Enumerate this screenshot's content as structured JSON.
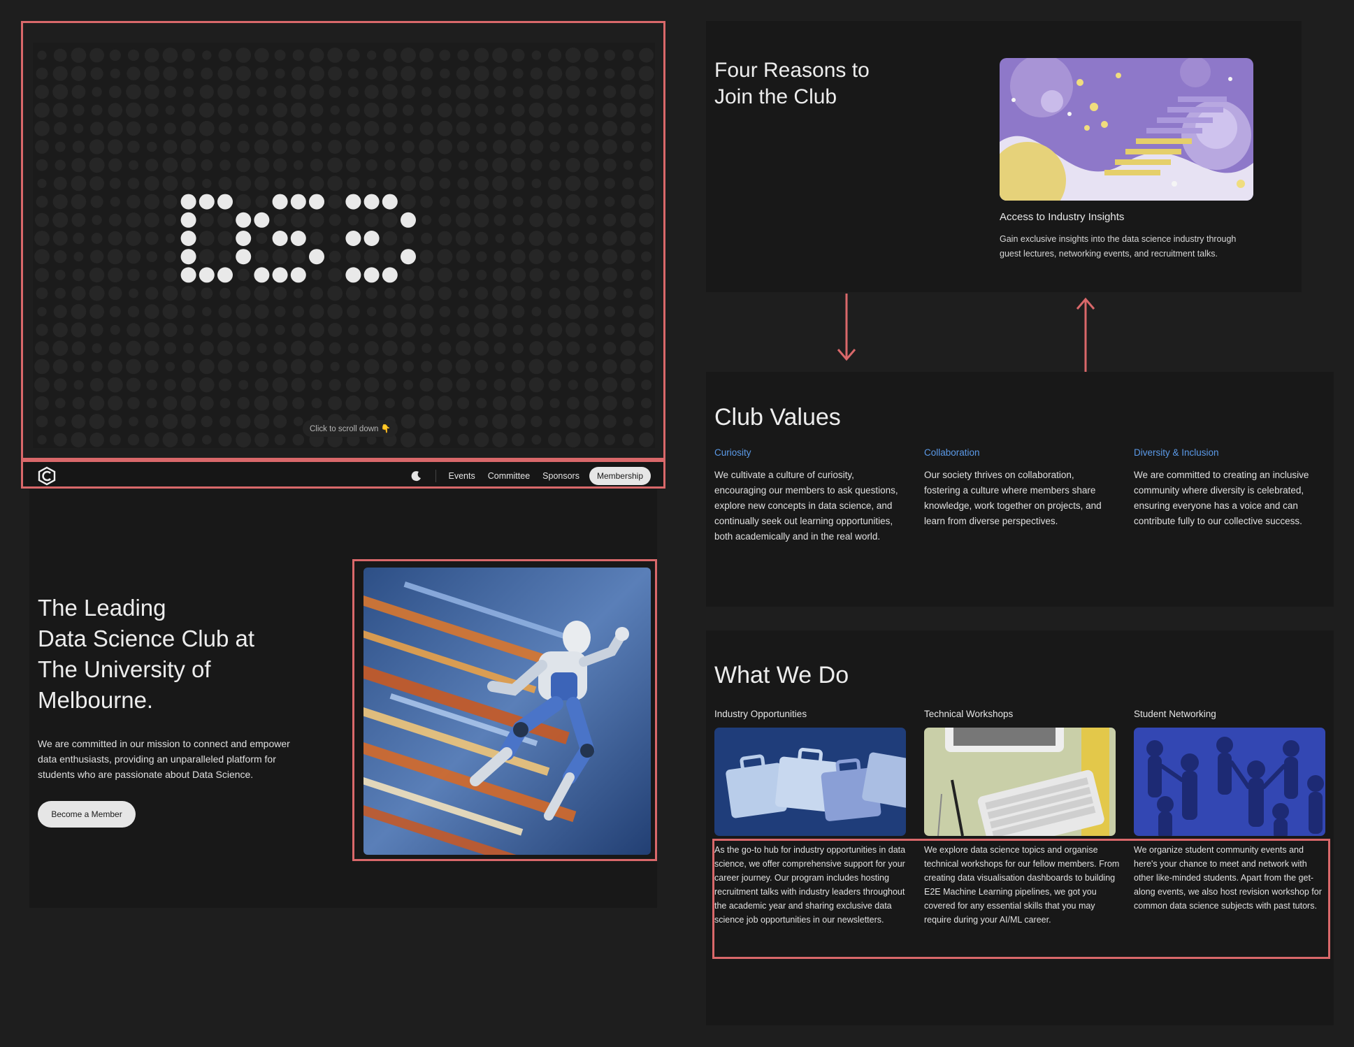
{
  "hero": {
    "scroll_hint": "Click to scroll down 👇"
  },
  "nav": {
    "items": [
      "Events",
      "Committee",
      "Sponsors"
    ],
    "membership": "Membership"
  },
  "intro": {
    "title_lines": [
      "The Leading",
      "Data Science Club at",
      "The University of",
      "Melbourne."
    ],
    "description": "We are committed in our mission to connect and empower data enthusiasts, providing an unparalleled platform for students who are passionate about Data Science.",
    "cta": "Become a Member"
  },
  "reasons": {
    "title_lines": [
      "Four Reasons to",
      "Join the Club"
    ],
    "card_heading": "Access to Industry Insights",
    "card_text": "Gain exclusive insights into the data science industry through guest lectures, networking events, and recruitment talks."
  },
  "values": {
    "title": "Club Values",
    "items": [
      {
        "heading": "Curiosity",
        "text": "We cultivate a culture of curiosity, encouraging our members to ask questions, explore new concepts in data science, and continually seek out learning opportunities, both academically and in the real world."
      },
      {
        "heading": "Collaboration",
        "text": "Our society thrives on collaboration, fostering a culture where members share knowledge, work together on projects, and learn from diverse perspectives."
      },
      {
        "heading": "Diversity & Inclusion",
        "text": "We are committed to creating an inclusive community where diversity is celebrated, ensuring everyone has a voice and can contribute fully to our collective success."
      }
    ]
  },
  "whatwedo": {
    "title": "What We Do",
    "items": [
      {
        "heading": "Industry Opportunities",
        "text": "As the go-to hub for industry opportunities in data science, we offer comprehensive support for your career journey. Our program includes hosting recruitment talks with industry leaders throughout the academic year and sharing exclusive data science job opportunities in our newsletters."
      },
      {
        "heading": "Technical Workshops",
        "text": "We explore data science topics and organise technical workshops for our fellow members. From creating data visualisation dashboards to building E2E Machine Learning pipelines, we got you covered for any essential skills that you may require during your AI/ML career."
      },
      {
        "heading": "Student Networking",
        "text": "We organize student community events and here's your chance to meet and network with other like-minded students. Apart from the get-along events, we also host revision workshop for common data science subjects with past tutors."
      }
    ]
  },
  "colors": {
    "annotation": "#d9686a",
    "accent_blue": "#5b9ae8",
    "background": "#1e1e1e",
    "panel": "#181818"
  },
  "icons": [
    "dsc-logo-icon",
    "moon-icon",
    "arrow-down-icon",
    "arrow-up-icon"
  ]
}
